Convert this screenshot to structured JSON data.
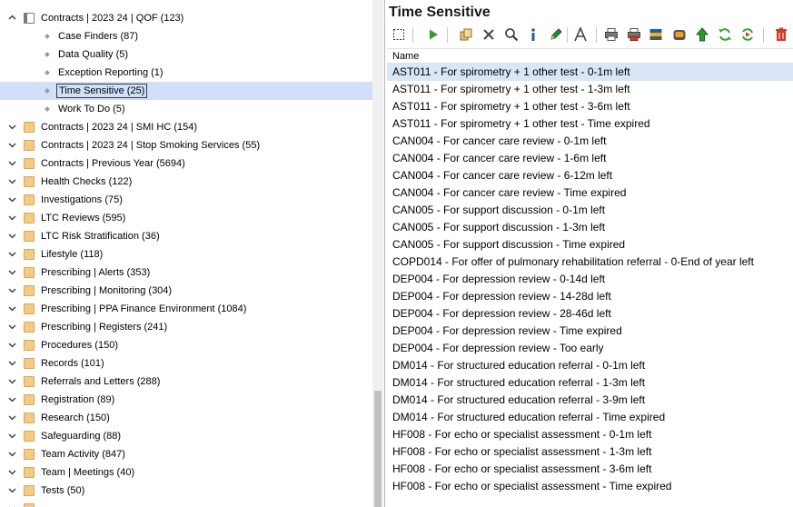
{
  "tree": {
    "parent": {
      "label": "Contracts | 2023 24 | QOF (123)"
    },
    "children": [
      {
        "label": "Case Finders (87)"
      },
      {
        "label": "Data Quality (5)"
      },
      {
        "label": "Exception Reporting (1)"
      },
      {
        "label": "Time Sensitive (25)",
        "selected": true
      },
      {
        "label": "Work To Do (5)"
      }
    ],
    "folders": [
      {
        "label": "Contracts | 2023 24 | SMI HC (154)"
      },
      {
        "label": "Contracts | 2023 24 | Stop Smoking Services (55)"
      },
      {
        "label": "Contracts | Previous Year (5694)"
      },
      {
        "label": "Health Checks (122)"
      },
      {
        "label": "Investigations (75)"
      },
      {
        "label": "LTC Reviews (595)"
      },
      {
        "label": "LTC Risk Stratification (36)"
      },
      {
        "label": "Lifestyle (118)"
      },
      {
        "label": "Prescribing | Alerts (353)"
      },
      {
        "label": "Prescribing | Monitoring (304)"
      },
      {
        "label": "Prescribing | PPA Finance Environment (1084)"
      },
      {
        "label": "Prescribing | Registers (241)"
      },
      {
        "label": "Procedures (150)"
      },
      {
        "label": "Records (101)"
      },
      {
        "label": "Referrals and Letters (288)"
      },
      {
        "label": "Registration (89)"
      },
      {
        "label": "Research (150)"
      },
      {
        "label": "Safeguarding (88)"
      },
      {
        "label": "Team Activity (847)"
      },
      {
        "label": "Team | Meetings (40)"
      },
      {
        "label": "Tests (50)"
      }
    ]
  },
  "panel": {
    "title": "Time Sensitive",
    "column_header": "Name",
    "items": [
      "AST011 - For spirometry + 1 other test - 0-1m left",
      "AST011 - For spirometry + 1 other test - 1-3m left",
      "AST011 - For spirometry + 1 other test - 3-6m left",
      "AST011 - For spirometry + 1 other test - Time expired",
      "CAN004 - For cancer care review - 0-1m left",
      "CAN004 - For cancer care review - 1-6m left",
      "CAN004 - For cancer care review - 6-12m left",
      "CAN004 - For cancer care review - Time expired",
      "CAN005 - For support discussion - 0-1m left",
      "CAN005 - For support discussion - 1-3m left",
      "CAN005 - For support discussion - Time expired",
      "COPD014 - For offer of pulmonary rehabilitation referral - 0-End of year left",
      "DEP004 - For depression review - 0-14d left",
      "DEP004 - For depression review - 14-28d left",
      "DEP004 - For depression review - 28-46d left",
      "DEP004 - For depression review - Time expired",
      "DEP004 - For depression review - Too early",
      "DM014 - For structured education referral - 0-1m left",
      "DM014 - For structured education referral - 1-3m left",
      "DM014 - For structured education referral - 3-9m left",
      "DM014 - For structured education referral - Time expired",
      "HF008 - For echo or specialist assessment - 0-1m left",
      "HF008 - For echo or specialist assessment - 1-3m left",
      "HF008 - For echo or specialist assessment - 3-6m left",
      "HF008 - For echo or specialist assessment - Time expired"
    ],
    "selected_index": 0
  },
  "toolbar": {
    "icons": [
      "select-icon",
      "run-icon",
      "copy-icon",
      "delete-icon",
      "search-icon",
      "info-icon",
      "edit-icon",
      "font-icon",
      "print-icon",
      "print-color-icon",
      "export-icon",
      "database-icon",
      "upload-icon",
      "refresh-icon",
      "refresh-run-icon",
      "trash-icon"
    ]
  },
  "colors": {
    "selection": "#cfe0f8",
    "folder": "#f3cb86",
    "accent_green": "#3a9a2a",
    "accent_red": "#d03a2a"
  }
}
